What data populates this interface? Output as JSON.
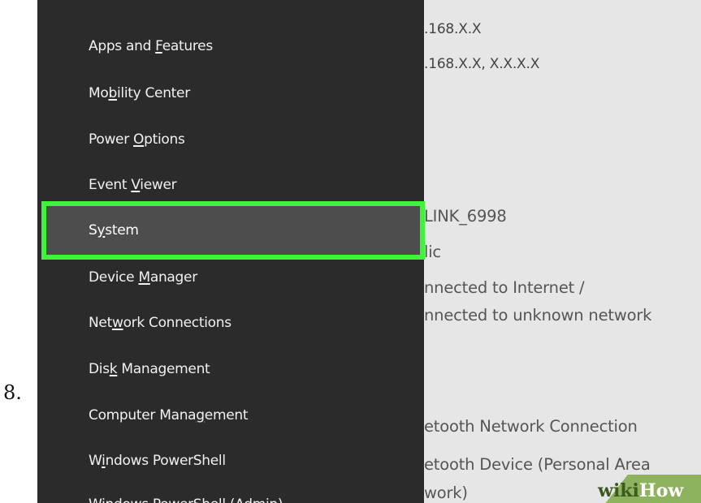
{
  "step_number": "8.",
  "background_window": {
    "lines": [
      {
        "id": "ipv4",
        "text": ".168.X.X"
      },
      {
        "id": "dns",
        "text": ".168.X.X, X.X.X.X"
      },
      {
        "id": "ssid",
        "text": "LINK_6998"
      },
      {
        "id": "profile",
        "text": "lic"
      },
      {
        "id": "status1",
        "text": "nnected to Internet /"
      },
      {
        "id": "status2",
        "text": "nnected to unknown network"
      },
      {
        "id": "bt1",
        "text": "etooth Network Connection"
      },
      {
        "id": "bt2",
        "text": "etooth Device (Personal Area"
      },
      {
        "id": "bt3",
        "text": "work)"
      }
    ]
  },
  "menu": {
    "items": [
      {
        "pre": "Apps and ",
        "key": "F",
        "post": "eatures"
      },
      {
        "pre": "Mo",
        "key": "b",
        "post": "ility Center"
      },
      {
        "pre": "Power ",
        "key": "O",
        "post": "ptions"
      },
      {
        "pre": "Event ",
        "key": "V",
        "post": "iewer"
      },
      {
        "pre": "S",
        "key": "y",
        "post": "stem",
        "selected": true
      },
      {
        "pre": "Device ",
        "key": "M",
        "post": "anager"
      },
      {
        "pre": "Net",
        "key": "w",
        "post": "ork Connections"
      },
      {
        "pre": "Dis",
        "key": "k",
        "post": " Management"
      },
      {
        "pre": "Computer Mana",
        "key": "g",
        "post": "ement"
      },
      {
        "pre": "W",
        "key": "i",
        "post": "ndows PowerShell"
      },
      {
        "pre": "Windows PowerShell (Admin)",
        "key": "",
        "post": ""
      }
    ]
  },
  "watermark": {
    "part1": "wiki",
    "part2": "How"
  },
  "colors": {
    "menu_bg": "#2b2b2b",
    "selected_bg": "#4d4d4d",
    "highlight_border": "#3ff23a",
    "background_window": "#e6e6e6",
    "watermark_bg": "#8db35e"
  }
}
